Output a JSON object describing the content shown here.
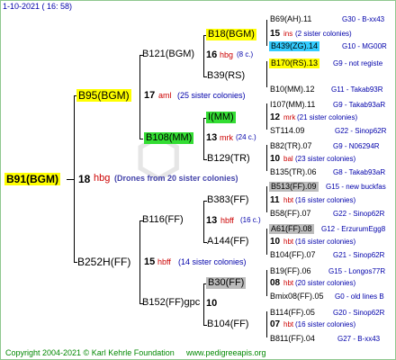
{
  "header": {
    "date": "1-10-2021 ( 16: 58)"
  },
  "footer": {
    "copyright": "Copyright 2004-2021 © Karl Kehrle Foundation",
    "site": "www.pedigreeapis.org"
  },
  "colors": {
    "yellow": "#ffff00",
    "green": "#33dd33",
    "cyan": "#33ccff",
    "gray": "#bbbbbb"
  },
  "g1": {
    "name": "B91(BGM)",
    "num": "18",
    "code": "hbg",
    "note": "(Drones from 20 sister colonies)"
  },
  "g2": [
    {
      "name": "B95(BGM)",
      "num": "17",
      "code": "aml",
      "note": "(25 sister colonies)"
    },
    {
      "name": "B252H(FF)",
      "num": "15",
      "code": "hbff",
      "note": "(14 sister colonies)"
    }
  ],
  "g3": [
    {
      "name": "B121(BGM)",
      "num": "16",
      "code": "hbg",
      "note": "(8 c.)"
    },
    {
      "name": "B108(MM)",
      "num": "13",
      "code": "mrk",
      "note": "(24 c.)"
    },
    {
      "name": "B116(FF)",
      "num": "13",
      "code": "hbff",
      "note": "(16 c.)"
    },
    {
      "name": "B152(FF)gpc",
      "num": "10",
      "code": "",
      "note": ""
    }
  ],
  "g4": [
    {
      "name": "B18(BGM)",
      "num": "15",
      "code": "ins",
      "note": "(2 sister colonies)"
    },
    {
      "name": "B39(RS)",
      "num": "",
      "code": "",
      "note": ""
    },
    {
      "name": "I(MM)",
      "num": "12",
      "code": "mrk",
      "note": "(21 sister colonies)"
    },
    {
      "name": "B129(TR)",
      "num": "10",
      "code": "bal",
      "note": "(23 sister colonies)"
    },
    {
      "name": "B383(FF)",
      "num": "11",
      "code": "hbt",
      "note": "(16 sister colonies)"
    },
    {
      "name": "A144(FF)",
      "num": "10",
      "code": "hbt",
      "note": "(16 sister colonies)"
    },
    {
      "name": "B30(FF)",
      "num": "08",
      "code": "hbt",
      "note": "(20 sister colonies)"
    },
    {
      "name": "B104(FF)",
      "num": "07",
      "code": "hbt",
      "note": "(16 sister colonies)"
    }
  ],
  "g5": [
    {
      "name": "B69(AH).11",
      "group": "G30 - B-xx43"
    },
    {
      "name": "B439(ZG).14",
      "group": "G10 - MG00R"
    },
    {
      "name": "B170(RS).13",
      "group": "G9 - not registe"
    },
    {
      "name": "B10(MM).12",
      "group": "G11 - Takab93R"
    },
    {
      "name": "I107(MM).11",
      "group": "G9 - Takab93aR"
    },
    {
      "name": "ST114.09",
      "group": "G22 - Sinop62R"
    },
    {
      "name": "B82(TR).07",
      "group": "G9 - N06294R"
    },
    {
      "name": "B135(TR).06",
      "group": "G8 - Takab93aR"
    },
    {
      "name": "B513(FF).09",
      "group": "G15 - new buckfas"
    },
    {
      "name": "B58(FF).07",
      "group": "G22 - Sinop62R"
    },
    {
      "name": "A61(FF).08",
      "group": "G12 - ErzurumEgg8"
    },
    {
      "name": "B104(FF).07",
      "group": "G21 - Sinop62R"
    },
    {
      "name": "B19(FF).06",
      "group": "G15 - Longos77R"
    },
    {
      "name": "Bmix08(FF).05",
      "group": "G0 - old lines B"
    },
    {
      "name": "B114(FF).05",
      "group": "G20 - Sinop62R"
    },
    {
      "name": "B811(FF).04",
      "group": "G27 - B-xx43"
    }
  ]
}
